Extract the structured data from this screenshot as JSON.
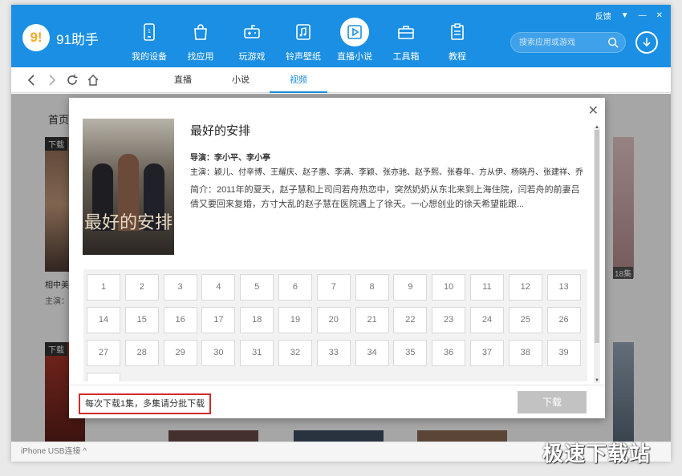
{
  "app": {
    "name": "91助手",
    "logo_mark": "9!"
  },
  "window": {
    "feedback": "反馈"
  },
  "nav": [
    {
      "label": "我的设备",
      "icon": "device-icon"
    },
    {
      "label": "找应用",
      "icon": "bag-icon"
    },
    {
      "label": "玩游戏",
      "icon": "gamepad-icon"
    },
    {
      "label": "铃声壁纸",
      "icon": "music-note-icon"
    },
    {
      "label": "直播小说",
      "icon": "play-icon",
      "active": true
    },
    {
      "label": "工具箱",
      "icon": "toolbox-icon"
    },
    {
      "label": "教程",
      "icon": "clipboard-icon"
    }
  ],
  "search": {
    "placeholder": "搜索应用或游戏"
  },
  "tabs": [
    {
      "label": "直播"
    },
    {
      "label": "小说"
    },
    {
      "label": "视频",
      "active": true
    }
  ],
  "breadcrumb": "首页 >",
  "background": {
    "card_badge": "下载",
    "card_title": "相中美人",
    "card_cast": "主演：周渝",
    "card_episodes": "18集"
  },
  "dialog": {
    "title": "最好的安排",
    "director": "导演：李小平、李小亭",
    "cast": "主演：颖儿、付辛博、王耀庆、赵子惠、李满、李颖、张亦驰、赵予熙、张春年、方从伊、杨晓丹、张建祥、乔红...",
    "summary": "简介：2011年的夏天，赵子慧和上司闫若舟热恋中，突然奶奶从东北来到上海住院，闫若舟的前妻吕倩又要回来复婚，方寸大乱的赵子慧在医院遇上了徐天。一心想创业的徐天希望能跟...",
    "poster_title": "最好的安排",
    "episodes": [
      "1",
      "2",
      "3",
      "4",
      "5",
      "6",
      "7",
      "8",
      "9",
      "10",
      "11",
      "12",
      "13",
      "14",
      "15",
      "16",
      "17",
      "18",
      "19",
      "20",
      "21",
      "22",
      "23",
      "24",
      "25",
      "26",
      "27",
      "28",
      "29",
      "30",
      "31",
      "32",
      "33",
      "34",
      "35",
      "36",
      "37",
      "38",
      "39",
      ""
    ],
    "hint": "每次下载1集，多集请分批下载",
    "download_label": "下载"
  },
  "status": {
    "connection": "iPhone  USB连接 ^"
  },
  "watermark": "极速下载站",
  "colors": {
    "brand": "#1a8fe3",
    "hint_border": "#d12b2b",
    "download_disabled": "#c2c2c2"
  }
}
